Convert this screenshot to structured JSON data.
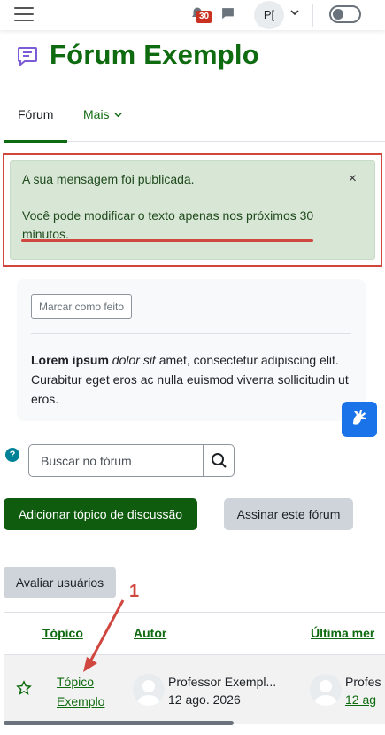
{
  "header": {
    "notifications_count": "30",
    "user_initials": "P["
  },
  "page": {
    "title": "Fórum Exemplo"
  },
  "tabs": [
    {
      "label": "Fórum"
    },
    {
      "label": "Mais"
    }
  ],
  "alert": {
    "line1": "A sua mensagem foi publicada.",
    "line2": "Você pode modificar o texto apenas nos próximos 30 minutos.",
    "close": "×"
  },
  "activity": {
    "mark_done_label": "Marcar como feito",
    "desc_bold": "Lorem ipsum",
    "desc_italic": "dolor sit",
    "desc_rest": "amet, consectetur adipiscing elit. Curabitur eget eros ac nulla euismod viverra sollicitudin ut eros."
  },
  "search": {
    "placeholder": "Buscar no fórum"
  },
  "actions": {
    "add_topic": "Adicionar tópico de discussão",
    "subscribe": "Assinar este fórum",
    "rate_users": "Avaliar usuários"
  },
  "annotation": {
    "number": "1"
  },
  "table": {
    "headers": [
      "Tópico",
      "Autor",
      "Última mer"
    ],
    "rows": [
      {
        "topic": "Tópico Exemplo",
        "author": "Professor Exempl...",
        "author_date": "12 ago. 2026",
        "last_author": "Profes",
        "last_date": "12 ag"
      }
    ]
  },
  "colors": {
    "brand": "#0f6b0f",
    "alert_bg": "#d7e6d5",
    "annotation": "#d0473f"
  }
}
